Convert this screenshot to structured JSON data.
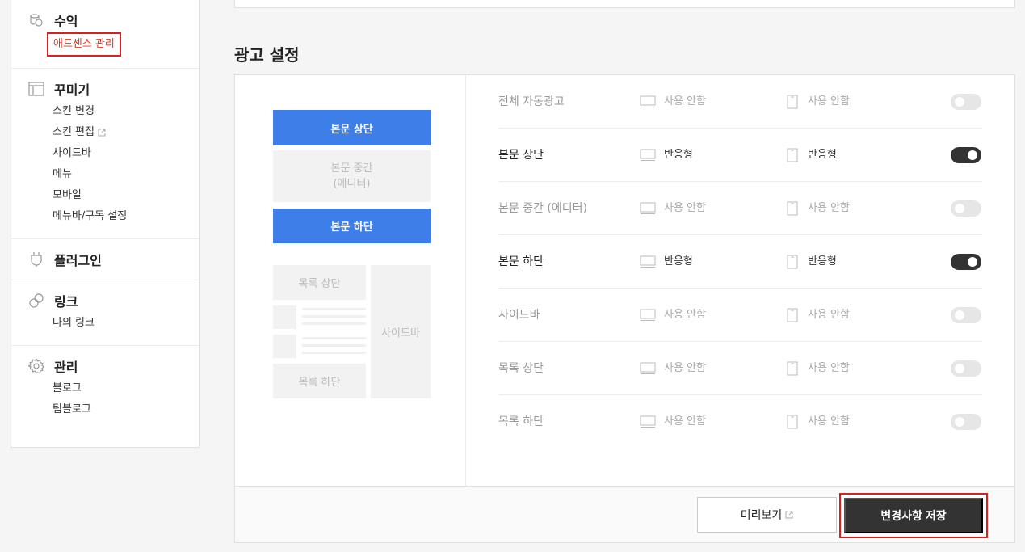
{
  "sidebar": {
    "revenue": {
      "title": "수익",
      "items": [
        {
          "label": "애드센스 관리"
        }
      ]
    },
    "decorate": {
      "title": "꾸미기",
      "items": [
        {
          "label": "스킨 변경"
        },
        {
          "label": "스킨 편집"
        },
        {
          "label": "사이드바"
        },
        {
          "label": "메뉴"
        },
        {
          "label": "모바일"
        },
        {
          "label": "메뉴바/구독 설정"
        }
      ]
    },
    "plugin": {
      "title": "플러그인"
    },
    "link": {
      "title": "링크",
      "items": [
        {
          "label": "나의 링크"
        }
      ]
    },
    "manage": {
      "title": "관리",
      "items": [
        {
          "label": "블로그"
        },
        {
          "label": "팀블로그"
        }
      ]
    }
  },
  "section_title": "광고 설정",
  "preview": {
    "body_top": "본문 상단",
    "body_mid_1": "본문 중간",
    "body_mid_2": "(에디터)",
    "body_bottom": "본문 하단",
    "list_top": "목록 상단",
    "list_bottom": "목록 하단",
    "sidebar": "사이드바"
  },
  "rows": [
    {
      "label": "전체 자동광고",
      "pc": "사용 안함",
      "mobile": "사용 안함",
      "enabled": false
    },
    {
      "label": "본문 상단",
      "pc": "반응형",
      "mobile": "반응형",
      "enabled": true
    },
    {
      "label": "본문 중간 (에디터)",
      "pc": "사용 안함",
      "mobile": "사용 안함",
      "enabled": false
    },
    {
      "label": "본문 하단",
      "pc": "반응형",
      "mobile": "반응형",
      "enabled": true
    },
    {
      "label": "사이드바",
      "pc": "사용 안함",
      "mobile": "사용 안함",
      "enabled": false
    },
    {
      "label": "목록 상단",
      "pc": "사용 안함",
      "mobile": "사용 안함",
      "enabled": false
    },
    {
      "label": "목록 하단",
      "pc": "사용 안함",
      "mobile": "사용 안함",
      "enabled": false
    }
  ],
  "buttons": {
    "preview": "미리보기",
    "save": "변경사항 저장"
  },
  "colors": {
    "accent": "#3d7ee8",
    "active_link": "#e6341f",
    "highlight": "#d92020",
    "dark": "#333333"
  }
}
